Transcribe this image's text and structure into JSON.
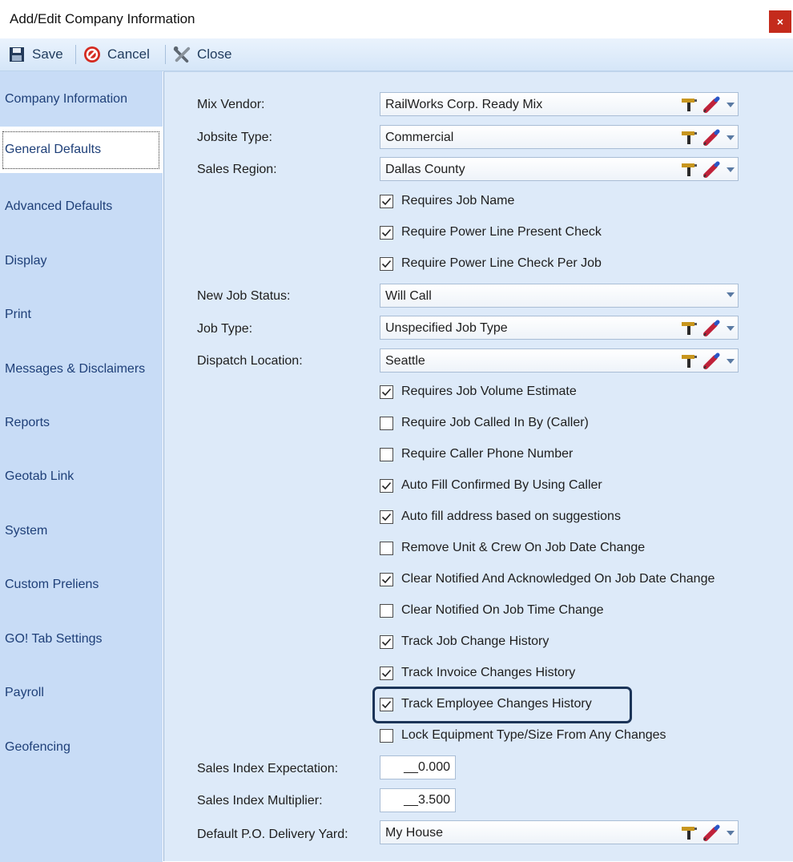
{
  "window": {
    "title": "Add/Edit Company Information",
    "close_glyph": "×"
  },
  "toolbar": {
    "save": "Save",
    "cancel": "Cancel",
    "close": "Close"
  },
  "sidebar": {
    "items": [
      "Company Information",
      "General Defaults",
      "Advanced Defaults",
      "Display",
      "Print",
      "Messages & Disclaimers",
      "Reports",
      "Geotab Link",
      "System",
      "Custom Preliens",
      "GO! Tab Settings",
      "Payroll",
      "Geofencing"
    ],
    "selected": "General Defaults"
  },
  "form": {
    "mix_vendor": {
      "label": "Mix Vendor:",
      "value": "RailWorks Corp. Ready Mix"
    },
    "jobsite_type": {
      "label": "Jobsite Type:",
      "value": "Commercial"
    },
    "sales_region": {
      "label": "Sales Region:",
      "value": "Dallas County"
    },
    "new_job_status": {
      "label": "New Job Status:",
      "value": "Will Call"
    },
    "job_type": {
      "label": "Job Type:",
      "value": "Unspecified Job Type"
    },
    "dispatch_location": {
      "label": "Dispatch Location:",
      "value": "Seattle"
    },
    "sales_index_expectation": {
      "label": "Sales Index Expectation:",
      "value": "__0.000"
    },
    "sales_index_multiplier": {
      "label": "Sales Index Multiplier:",
      "value": "__3.500"
    },
    "default_po_delivery_yard": {
      "label": "Default P.O. Delivery Yard:",
      "value": "My House"
    }
  },
  "checkboxes_a": [
    {
      "label": "Requires Job Name",
      "checked": true
    },
    {
      "label": "Require Power Line Present Check",
      "checked": true
    },
    {
      "label": "Require Power Line Check Per Job",
      "checked": true
    }
  ],
  "checkboxes_b": [
    {
      "label": "Requires Job Volume Estimate",
      "checked": true
    },
    {
      "label": "Require Job Called In By (Caller)",
      "checked": false
    },
    {
      "label": "Require Caller Phone Number",
      "checked": false
    },
    {
      "label": "Auto Fill Confirmed By Using Caller",
      "checked": true
    },
    {
      "label": "Auto fill address based on suggestions",
      "checked": true
    },
    {
      "label": "Remove Unit & Crew On Job Date Change",
      "checked": false
    },
    {
      "label": "Clear Notified And Acknowledged On Job Date Change",
      "checked": true
    },
    {
      "label": "Clear Notified On Job Time Change",
      "checked": false
    },
    {
      "label": "Track Job Change History",
      "checked": true
    },
    {
      "label": "Track Invoice Changes History",
      "checked": true
    },
    {
      "label": "Track Employee Changes History",
      "checked": true
    },
    {
      "label": "Lock Equipment Type/Size From Any Changes",
      "checked": false
    }
  ],
  "icons": {
    "save": "save-icon",
    "cancel": "cancel-icon",
    "close": "close-tools-icon",
    "lookup": "drill-icon",
    "edit": "pencil-icon",
    "dropdown": "chevron-down-icon"
  },
  "colors": {
    "accent": "#1e3f78",
    "highlight_border": "#1b3458",
    "close_button": "#c42b1c"
  }
}
